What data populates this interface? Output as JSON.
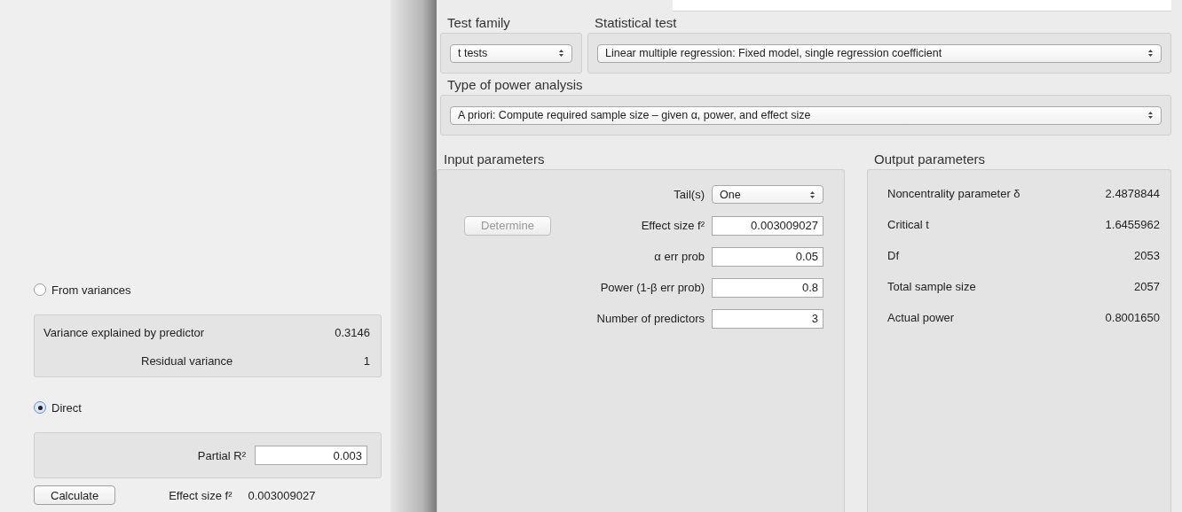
{
  "effect_size_panel": {
    "options": [
      {
        "label": "From variances",
        "selected": false,
        "rows": [
          {
            "label": "Variance explained by predictor",
            "value": "0.3146"
          },
          {
            "label": "Residual variance",
            "value": "1"
          }
        ]
      },
      {
        "label": "Direct",
        "selected": true,
        "field": {
          "label": "Partial R²",
          "value": "0.003"
        }
      }
    ],
    "calculate_button": "Calculate",
    "result": {
      "label": "Effect size f²",
      "value": "0.003009027"
    }
  },
  "test_family": {
    "label": "Test family",
    "value": "t tests"
  },
  "statistical_test": {
    "label": "Statistical test",
    "value": "Linear multiple regression: Fixed model, single regression coefficient"
  },
  "power_analysis_type": {
    "label": "Type of power analysis",
    "value": "A priori: Compute required sample size – given α, power, and effect size"
  },
  "input_parameters": {
    "title": "Input parameters",
    "determine_button": {
      "label": "Determine",
      "disabled": true
    },
    "fields": [
      {
        "label": "Tail(s)",
        "kind": "select",
        "value": "One"
      },
      {
        "label": "Effect size f²",
        "kind": "input",
        "value": "0.003009027"
      },
      {
        "label": "α err prob",
        "kind": "input",
        "value": "0.05"
      },
      {
        "label": "Power (1-β err prob)",
        "kind": "input",
        "value": "0.8"
      },
      {
        "label": "Number of predictors",
        "kind": "input",
        "value": "3"
      }
    ]
  },
  "output_parameters": {
    "title": "Output parameters",
    "rows": [
      {
        "label": "Noncentrality parameter δ",
        "value": "2.4878844"
      },
      {
        "label": "Critical t",
        "value": "1.6455962"
      },
      {
        "label": "Df",
        "value": "2053"
      },
      {
        "label": "Total sample size",
        "value": "2057"
      },
      {
        "label": "Actual power",
        "value": "0.8001650"
      }
    ]
  }
}
